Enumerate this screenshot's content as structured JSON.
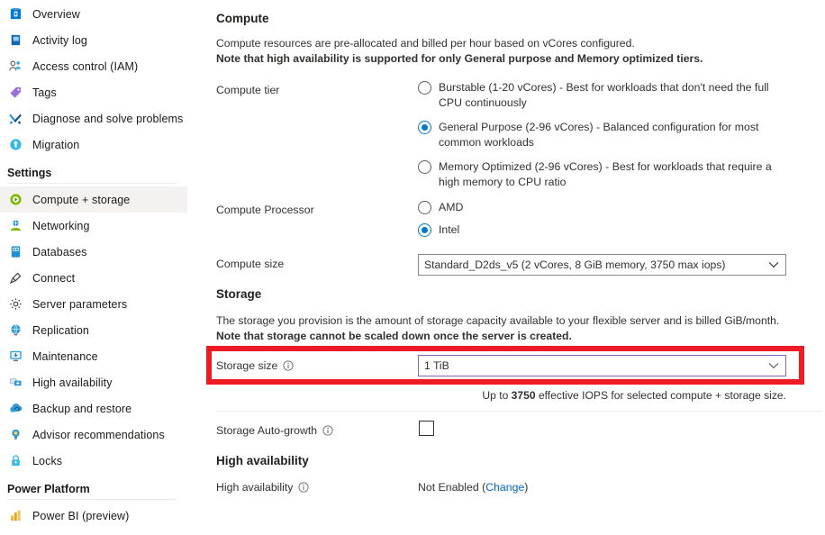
{
  "sidebar": {
    "items": [
      {
        "label": "Overview",
        "icon": "overview-icon",
        "selected": false
      },
      {
        "label": "Activity log",
        "icon": "activity-log-icon",
        "selected": false
      },
      {
        "label": "Access control (IAM)",
        "icon": "access-control-icon",
        "selected": false
      },
      {
        "label": "Tags",
        "icon": "tags-icon",
        "selected": false
      },
      {
        "label": "Diagnose and solve problems",
        "icon": "diagnose-icon",
        "selected": false
      },
      {
        "label": "Migration",
        "icon": "migration-icon",
        "selected": false
      }
    ],
    "settings_group": "Settings",
    "settings_items": [
      {
        "label": "Compute + storage",
        "icon": "compute-storage-icon",
        "selected": true
      },
      {
        "label": "Networking",
        "icon": "networking-icon",
        "selected": false
      },
      {
        "label": "Databases",
        "icon": "databases-icon",
        "selected": false
      },
      {
        "label": "Connect",
        "icon": "connect-icon",
        "selected": false
      },
      {
        "label": "Server parameters",
        "icon": "server-parameters-icon",
        "selected": false
      },
      {
        "label": "Replication",
        "icon": "replication-icon",
        "selected": false
      },
      {
        "label": "Maintenance",
        "icon": "maintenance-icon",
        "selected": false
      },
      {
        "label": "High availability",
        "icon": "high-availability-icon",
        "selected": false
      },
      {
        "label": "Backup and restore",
        "icon": "backup-restore-icon",
        "selected": false
      },
      {
        "label": "Advisor recommendations",
        "icon": "advisor-icon",
        "selected": false
      },
      {
        "label": "Locks",
        "icon": "locks-icon",
        "selected": false
      }
    ],
    "power_platform_group": "Power Platform",
    "power_platform_items": [
      {
        "label": "Power BI (preview)",
        "icon": "power-bi-icon",
        "selected": false
      }
    ]
  },
  "main": {
    "compute_heading": "Compute",
    "compute_desc_line1": "Compute resources are pre-allocated and billed per hour based on vCores configured.",
    "compute_desc_line2": "Note that high availability is supported for only General purpose and Memory optimized tiers.",
    "compute_tier_label": "Compute tier",
    "compute_tier_options": [
      {
        "text": "Burstable (1-20 vCores) - Best for workloads that don't need the full CPU continuously",
        "selected": false
      },
      {
        "text": "General Purpose (2-96 vCores) - Balanced configuration for most common workloads",
        "selected": true
      },
      {
        "text": "Memory Optimized (2-96 vCores) - Best for workloads that require a high memory to CPU ratio",
        "selected": false
      }
    ],
    "compute_processor_label": "Compute Processor",
    "compute_processor_options": [
      {
        "text": "AMD",
        "selected": false
      },
      {
        "text": "Intel",
        "selected": true
      }
    ],
    "compute_size_label": "Compute size",
    "compute_size_value": "Standard_D2ds_v5 (2 vCores, 8 GiB memory, 3750 max iops)",
    "storage_heading": "Storage",
    "storage_desc_line1": "The storage you provision is the amount of storage capacity available to your flexible server and is billed GiB/month.",
    "storage_desc_line2": "Note that storage cannot be scaled down once the server is created.",
    "storage_size_label": "Storage size",
    "storage_size_value": "1 TiB",
    "iops_prefix": "Up to ",
    "iops_value": "3750",
    "iops_suffix": " effective IOPS for selected compute + storage size.",
    "auto_growth_label": "Storage Auto-growth",
    "auto_growth_checked": false,
    "ha_heading": "High availability",
    "ha_label": "High availability",
    "ha_value": "Not Enabled (",
    "ha_link": "Change",
    "ha_value_tail": ")"
  },
  "colors": {
    "accent": "#0078d4",
    "visited_border": "#8764b8",
    "highlight_box": "#ee1b24",
    "link": "#0066cc",
    "selected_nav_bg": "#f3f2f1"
  }
}
